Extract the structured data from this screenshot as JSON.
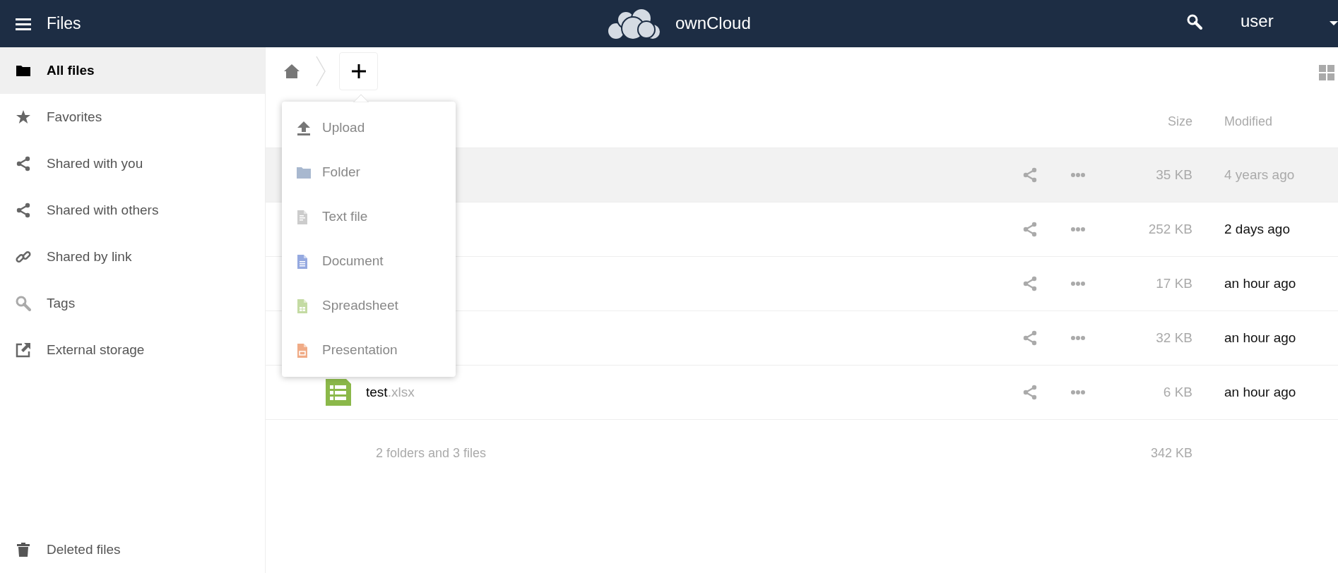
{
  "header": {
    "app_title": "Files",
    "brand": "ownCloud",
    "user": "user"
  },
  "sidebar": {
    "items": [
      {
        "label": "All files",
        "kind": "folder",
        "selected": true
      },
      {
        "label": "Favorites",
        "kind": "star",
        "selected": false
      },
      {
        "label": "Shared with you",
        "kind": "share",
        "selected": false
      },
      {
        "label": "Shared with others",
        "kind": "share",
        "selected": false
      },
      {
        "label": "Shared by link",
        "kind": "link",
        "selected": false
      },
      {
        "label": "Tags",
        "kind": "search",
        "selected": false
      },
      {
        "label": "External storage",
        "kind": "external",
        "selected": false
      }
    ],
    "bottom_item": {
      "label": "Deleted files",
      "kind": "trash",
      "selected": false
    }
  },
  "new_menu": {
    "items": [
      {
        "label": "Upload",
        "kind": "upload"
      },
      {
        "label": "Folder",
        "kind": "folder"
      },
      {
        "label": "Text file",
        "kind": "text"
      },
      {
        "label": "Document",
        "kind": "document"
      },
      {
        "label": "Spreadsheet",
        "kind": "spreadsheet"
      },
      {
        "label": "Presentation",
        "kind": "presentation"
      }
    ]
  },
  "table": {
    "columns": [
      "Size",
      "Modified"
    ],
    "rows": [
      {
        "size": "35 KB",
        "modified": "4 years ago",
        "recent": false,
        "highlighted": true
      },
      {
        "size": "252 KB",
        "modified": "2 days ago",
        "recent": true,
        "highlighted": false
      },
      {
        "size": "17 KB",
        "modified": "an hour ago",
        "recent": true,
        "highlighted": false
      },
      {
        "size": "32 KB",
        "modified": "an hour ago",
        "recent": true,
        "highlighted": false
      },
      {
        "name": "test",
        "extension": ".xlsx",
        "kind": "spreadsheet",
        "size": "6 KB",
        "modified": "an hour ago",
        "recent": true,
        "highlighted": false
      }
    ],
    "summary": {
      "text": "2 folders and 3 files",
      "size": "342 KB"
    }
  }
}
